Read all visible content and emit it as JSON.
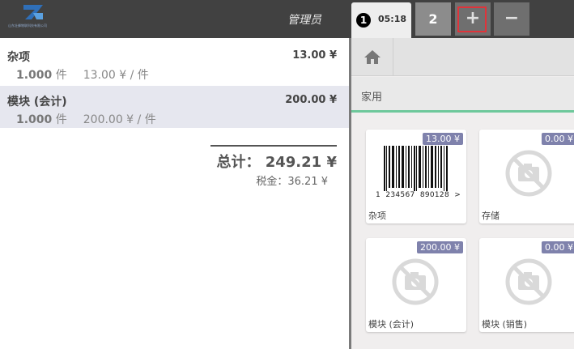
{
  "topbar": {
    "company_name": "山东壮蜂物联科技有限公司",
    "username": "管理员",
    "orders": [
      {
        "number": "1",
        "time": "05:18",
        "active": true
      },
      {
        "number": "2",
        "active": false
      }
    ],
    "add_order_label": "+",
    "remove_order_label": "−"
  },
  "order": {
    "lines": [
      {
        "name": "杂项",
        "price": "13.00 ¥",
        "qty": "1.000",
        "unit": "件",
        "unit_price": "13.00 ¥ / 件",
        "selected": false
      },
      {
        "name": "模块 (会计)",
        "price": "200.00 ¥",
        "qty": "1.000",
        "unit": "件",
        "unit_price": "200.00 ¥ / 件",
        "selected": true
      }
    ],
    "total_label": "总计：",
    "total_value": "249.21 ¥",
    "tax_label": "税金：",
    "tax_value": "36.21 ¥"
  },
  "category": {
    "current": "家用"
  },
  "products": [
    {
      "name": "杂项",
      "price": "13.00 ¥",
      "image": "barcode-image",
      "barcode_text": "1  234567  890128  >"
    },
    {
      "name": "存储",
      "price": "0.00 ¥",
      "image": "no-image-icon"
    },
    {
      "name": "模块 (会计)",
      "price": "200.00 ¥",
      "image": "no-image-icon"
    },
    {
      "name": "模块 (销售)",
      "price": "0.00 ¥",
      "image": "no-image-icon"
    }
  ],
  "colors": {
    "topbar": "#414141",
    "selected_line": "#e6e7ef",
    "price_tag": "#7f82ac",
    "category_accent": "#6ec89b",
    "highlight": "#e0333a"
  }
}
